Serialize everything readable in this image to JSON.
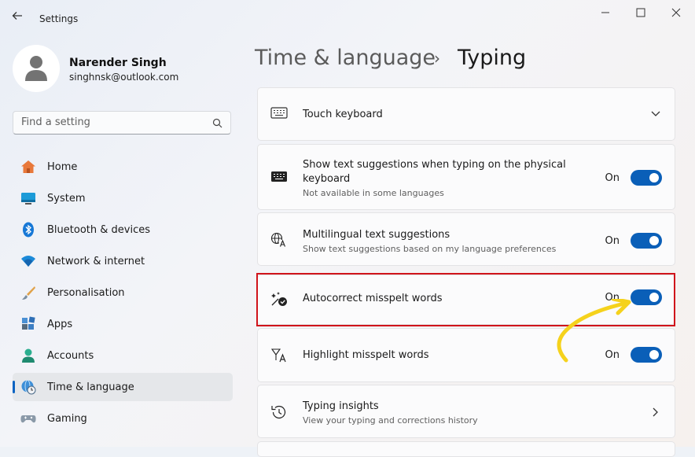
{
  "window": {
    "title": "Settings"
  },
  "user": {
    "name": "Narender Singh",
    "email": "singhnsk@outlook.com"
  },
  "search": {
    "placeholder": "Find a setting"
  },
  "nav": [
    {
      "label": "Home",
      "icon": "home-icon"
    },
    {
      "label": "System",
      "icon": "system-icon"
    },
    {
      "label": "Bluetooth & devices",
      "icon": "bluetooth-icon"
    },
    {
      "label": "Network & internet",
      "icon": "wifi-icon"
    },
    {
      "label": "Personalisation",
      "icon": "brush-icon"
    },
    {
      "label": "Apps",
      "icon": "apps-icon"
    },
    {
      "label": "Accounts",
      "icon": "accounts-icon"
    },
    {
      "label": "Time & language",
      "icon": "globe-clock-icon",
      "active": true
    },
    {
      "label": "Gaming",
      "icon": "gamepad-icon"
    }
  ],
  "breadcrumb": {
    "parent": "Time & language",
    "separator": "›",
    "current": "Typing"
  },
  "settings": {
    "touch_keyboard": {
      "title": "Touch keyboard"
    },
    "text_suggestions": {
      "title_line1": "Show text suggestions when typing on the physical",
      "title_line2": "keyboard",
      "subtitle": "Not available in some languages",
      "state": "On"
    },
    "multilingual": {
      "title": "Multilingual text suggestions",
      "subtitle": "Show text suggestions based on my language preferences",
      "state": "On"
    },
    "autocorrect": {
      "title": "Autocorrect misspelt words",
      "state": "On"
    },
    "highlight": {
      "title": "Highlight misspelt words",
      "state": "On"
    },
    "insights": {
      "title": "Typing insights",
      "subtitle": "View your typing and corrections history"
    }
  },
  "colors": {
    "accent": "#0a5fb8",
    "highlight_border": "#d0141b",
    "annotation_arrow": "#f5d21c"
  }
}
